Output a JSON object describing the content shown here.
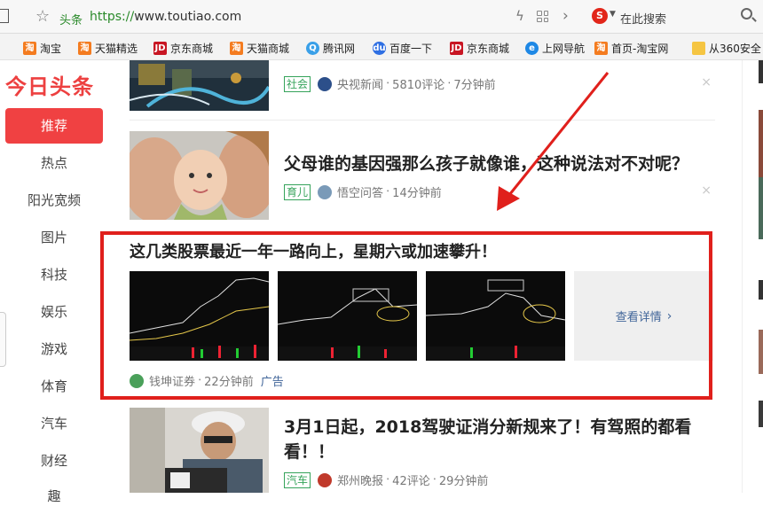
{
  "browser": {
    "site_name": "头条",
    "url_scheme": "https://",
    "url_rest": "www.toutiao.com",
    "search_placeholder": "在此搜索",
    "engine_icon_label": "S"
  },
  "bookmarks": [
    {
      "label": "淘宝",
      "icon": "taobao-icon",
      "glyph": "淘"
    },
    {
      "label": "天猫精选",
      "icon": "taobao-icon",
      "glyph": "淘"
    },
    {
      "label": "京东商城",
      "icon": "jd-icon",
      "glyph": "JD"
    },
    {
      "label": "天猫商城",
      "icon": "taobao-icon",
      "glyph": "淘"
    },
    {
      "label": "腾讯网",
      "icon": "qq-icon",
      "glyph": "Q"
    },
    {
      "label": "百度一下",
      "icon": "baidu-icon",
      "glyph": "du"
    },
    {
      "label": "京东商城",
      "icon": "jd-icon",
      "glyph": "JD"
    },
    {
      "label": "上网导航",
      "icon": "nav-icon",
      "glyph": "e"
    },
    {
      "label": "首页-淘宝网",
      "icon": "taobao-icon",
      "glyph": "淘"
    },
    {
      "label": "从360安全",
      "icon": "folder-icon",
      "glyph": ""
    }
  ],
  "sidebar": {
    "logo": "今日头条",
    "items": [
      {
        "label": "推荐",
        "active": true
      },
      {
        "label": "热点"
      },
      {
        "label": "阳光宽频"
      },
      {
        "label": "图片"
      },
      {
        "label": "科技"
      },
      {
        "label": "娱乐"
      },
      {
        "label": "游戏"
      },
      {
        "label": "体育"
      },
      {
        "label": "汽车"
      },
      {
        "label": "财经"
      },
      {
        "label": "趣"
      }
    ]
  },
  "feed": {
    "items": [
      {
        "title": "",
        "tag": "社会",
        "source": "央视新闻",
        "comments": "5810评论",
        "time": "7分钟前"
      },
      {
        "title": "父母谁的基因强那么孩子就像谁，这种说法对不对呢？",
        "tag": "育儿",
        "source": "悟空问答",
        "comments": "",
        "time": "14分钟前"
      },
      {
        "title": "3月1日起，2018驾驶证消分新规来了！有驾照的都看看！！",
        "tag": "汽车",
        "source": "郑州晚报",
        "comments": "42评论",
        "time": "29分钟前"
      }
    ],
    "close_glyph": "×"
  },
  "ad": {
    "title": "这几类股票最近一年一路向上，星期六或加速攀升！",
    "more_label": "查看详情",
    "source": "钱坤证券",
    "time": "22分钟前",
    "ad_label": "广告"
  }
}
